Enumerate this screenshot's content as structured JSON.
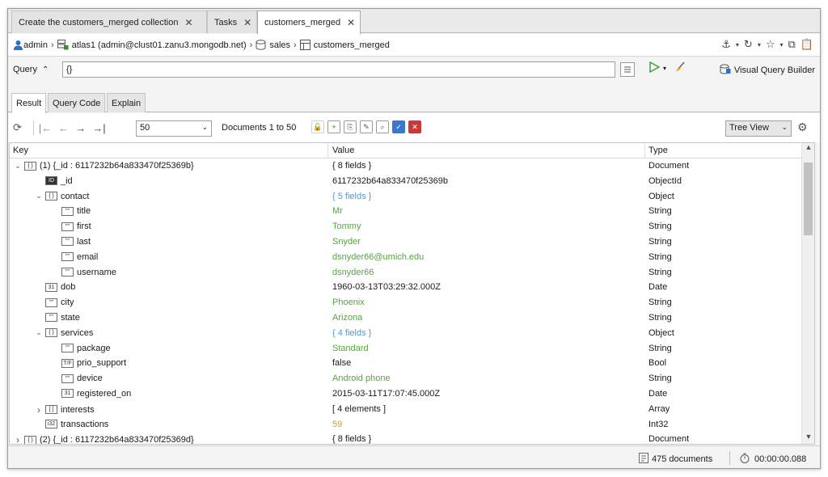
{
  "tabs": [
    {
      "label": "Create the customers_merged collection",
      "active": false
    },
    {
      "label": "Tasks",
      "active": false
    },
    {
      "label": "customers_merged",
      "active": true
    }
  ],
  "breadcrumb": {
    "user": "admin",
    "connection": "atlas1 (admin@clust01.zanu3.mongodb.net)",
    "database": "sales",
    "collection": "customers_merged"
  },
  "query": {
    "label": "Query",
    "value": "{}",
    "visual_query_builder": "Visual Query Builder"
  },
  "subtabs": [
    {
      "label": "Result",
      "active": true
    },
    {
      "label": "Query Code",
      "active": false
    },
    {
      "label": "Explain",
      "active": false
    }
  ],
  "toolbar": {
    "page_size": "50",
    "documents_range": "Documents 1 to 50",
    "view_mode": "Tree View"
  },
  "grid": {
    "columns": [
      "Key",
      "Value",
      "Type"
    ],
    "rows": [
      {
        "key": "(1) {_id : 6117232b64a833470f25369b}",
        "value": "{ 8 fields }",
        "type": "Document",
        "depth": 0,
        "expand": "down",
        "icon": "{}",
        "color": "normal"
      },
      {
        "key": "_id",
        "value": "6117232b64a833470f25369b",
        "type": "ObjectId",
        "depth": 1,
        "expand": "",
        "icon": "id",
        "color": "normal"
      },
      {
        "key": "contact",
        "value": "{ 5 fields }",
        "type": "Object",
        "depth": 1,
        "expand": "down",
        "icon": "{}",
        "color": "blue"
      },
      {
        "key": "title",
        "value": "Mr",
        "type": "String",
        "depth": 2,
        "expand": "",
        "icon": "\"\"",
        "color": "green"
      },
      {
        "key": "first",
        "value": "Tommy",
        "type": "String",
        "depth": 2,
        "expand": "",
        "icon": "\"\"",
        "color": "green"
      },
      {
        "key": "last",
        "value": "Snyder",
        "type": "String",
        "depth": 2,
        "expand": "",
        "icon": "\"\"",
        "color": "green"
      },
      {
        "key": "email",
        "value": "dsnyder66@umich.edu",
        "type": "String",
        "depth": 2,
        "expand": "",
        "icon": "\"\"",
        "color": "green"
      },
      {
        "key": "username",
        "value": "dsnyder66",
        "type": "String",
        "depth": 2,
        "expand": "",
        "icon": "\"\"",
        "color": "green"
      },
      {
        "key": "dob",
        "value": "1960-03-13T03:29:32.000Z",
        "type": "Date",
        "depth": 1,
        "expand": "",
        "icon": "31",
        "color": "normal"
      },
      {
        "key": "city",
        "value": "Phoenix",
        "type": "String",
        "depth": 1,
        "expand": "",
        "icon": "\"\"",
        "color": "green"
      },
      {
        "key": "state",
        "value": "Arizona",
        "type": "String",
        "depth": 1,
        "expand": "",
        "icon": "\"\"",
        "color": "green"
      },
      {
        "key": "services",
        "value": "{ 4 fields }",
        "type": "Object",
        "depth": 1,
        "expand": "down",
        "icon": "{}",
        "color": "blue"
      },
      {
        "key": "package",
        "value": "Standard",
        "type": "String",
        "depth": 2,
        "expand": "",
        "icon": "\"\"",
        "color": "green"
      },
      {
        "key": "prio_support",
        "value": "false",
        "type": "Bool",
        "depth": 2,
        "expand": "",
        "icon": "T/F",
        "color": "normal"
      },
      {
        "key": "device",
        "value": "Android phone",
        "type": "String",
        "depth": 2,
        "expand": "",
        "icon": "\"\"",
        "color": "green"
      },
      {
        "key": "registered_on",
        "value": "2015-03-11T17:07:45.000Z",
        "type": "Date",
        "depth": 2,
        "expand": "",
        "icon": "31",
        "color": "normal"
      },
      {
        "key": "interests",
        "value": "[ 4 elements ]",
        "type": "Array",
        "depth": 1,
        "expand": "right",
        "icon": "[]",
        "color": "normal"
      },
      {
        "key": "transactions",
        "value": "59",
        "type": "Int32",
        "depth": 1,
        "expand": "",
        "icon": "i32",
        "color": "orange"
      },
      {
        "key": "(2) {_id : 6117232b64a833470f25369d}",
        "value": "{ 8 fields }",
        "type": "Document",
        "depth": 0,
        "expand": "right",
        "icon": "{}",
        "color": "normal"
      }
    ]
  },
  "status": {
    "documents": "475 documents",
    "elapsed": "00:00:00.088"
  },
  "colors": {
    "string_value": "#52a83a",
    "object_value": "#4c9ad8",
    "number_value": "#d29a3a"
  }
}
